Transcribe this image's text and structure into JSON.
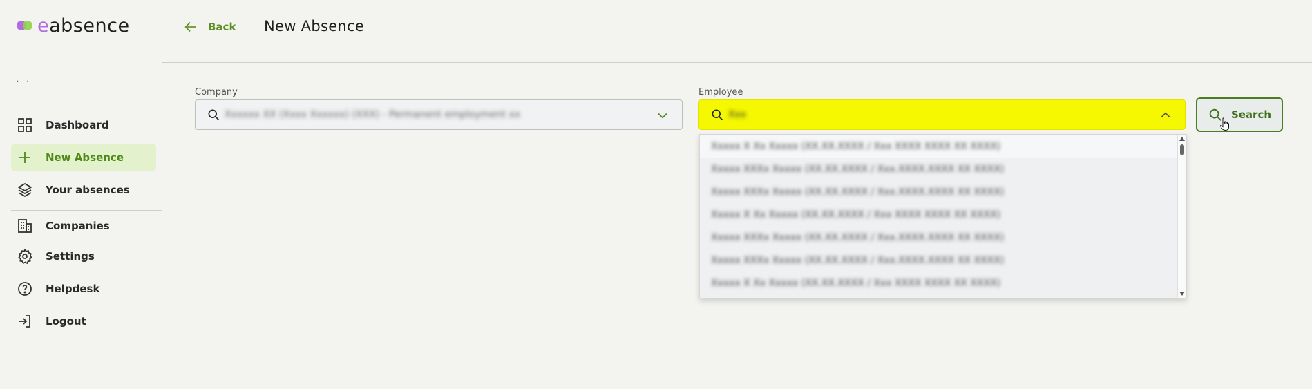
{
  "app": {
    "brand_prefix": "e",
    "brand_suffix": "absence",
    "user_hint": ". ."
  },
  "sidebar": {
    "items": [
      {
        "label": "Dashboard",
        "icon": "grid-icon",
        "active": false
      },
      {
        "label": "New Absence",
        "icon": "plus-icon",
        "active": true
      },
      {
        "label": "Your absences",
        "icon": "layers-icon",
        "active": false
      },
      {
        "label": "Companies",
        "icon": "building-icon",
        "active": false
      },
      {
        "label": "Settings",
        "icon": "gear-icon",
        "active": false
      },
      {
        "label": "Helpdesk",
        "icon": "help-icon",
        "active": false
      },
      {
        "label": "Logout",
        "icon": "logout-icon",
        "active": false
      }
    ]
  },
  "header": {
    "back_label": "Back",
    "title": "New Absence"
  },
  "form": {
    "company": {
      "label": "Company",
      "value": "Xxxxxx XX (Xxxx Xxxxxx) (XXX) - Permanent employment xx"
    },
    "employee": {
      "label": "Employee",
      "value": "Xxx"
    },
    "search_label": "Search"
  },
  "dropdown": {
    "items": [
      "Xxxxx X Xx Xxxxx (XX.XX.XXXX / Xxx XXXX XXXX XX XXXX)",
      "Xxxxx XXXx Xxxxx (XX.XX.XXXX / Xxx.XXXX.XXXX XX XXXX)",
      "Xxxxx XXXx Xxxxx (XX.XX.XXXX / Xxx.XXXX.XXXX XX XXXX)",
      "Xxxxx X Xx Xxxxx (XX.XX.XXXX / Xxx XXXX XXXX XX XXXX)",
      "Xxxxx XXXx Xxxxx (XX.XX.XXXX / Xxx.XXXX.XXXX XX XXXX)",
      "Xxxxx XXXx Xxxxx (XX.XX.XXXX / Xxx.XXXX.XXXX XX XXXX)",
      "Xxxxx X Xx Xxxxx (XX.XX.XXXX / Xxx XXXX XXXX XX XXXX)"
    ]
  },
  "colors": {
    "accent": "#5d8f23",
    "active_bg": "#e3f2cc",
    "highlight": "#f5f800",
    "brand_purple": "#b46be0"
  }
}
